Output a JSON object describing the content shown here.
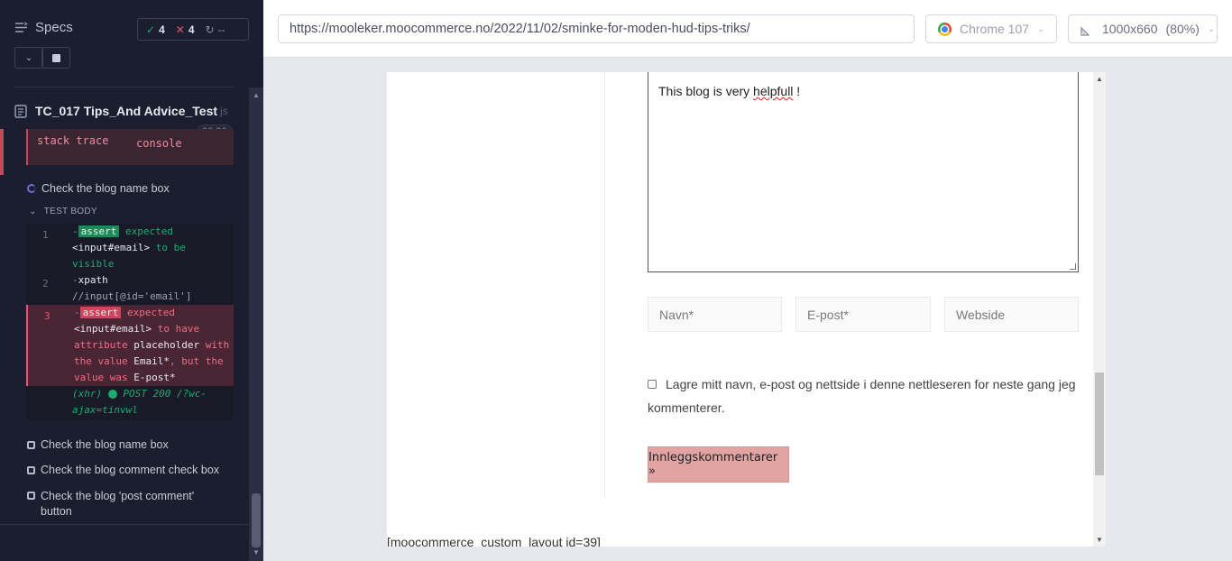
{
  "reporter": {
    "specs_label": "Specs",
    "stats": {
      "passed": "4",
      "failed": "4",
      "pending": "--"
    },
    "spec_file": {
      "name": "TC_017 Tips_And Advice_Test",
      "ext": "js"
    },
    "duration": "00:26",
    "error_links": {
      "stack_trace": "stack trace",
      "console": "console"
    },
    "active_test": "Check the blog name box",
    "test_body_label": "TEST BODY",
    "commands": [
      {
        "num": "1",
        "tag": "assert",
        "text_a": "expected",
        "text_b": "<input#email>",
        "text_c": "to be visible"
      },
      {
        "num": "2",
        "name": "xpath",
        "text_a": "//input[@id='email']"
      },
      {
        "num": "3",
        "tag": "assert",
        "text_a": "expected",
        "text_b": "<input#email>",
        "text_c": "to have attribute",
        "text_d": "placeholder",
        "text_e": "with the value",
        "text_f": "Email*",
        "text_g": ", but the value was",
        "text_h": "E-post*"
      }
    ],
    "xhr": {
      "label": "(xhr)",
      "text": "POST 200 /?wc-ajax=tinvwl"
    },
    "tests": [
      "Check the blog name box",
      "Check the blog comment check box",
      "Check the blog 'post comment' button"
    ]
  },
  "topbar": {
    "url": "https://mooleker.moocommerce.no/2022/11/02/sminke-for-moden-hud-tips-triks/",
    "browser": "Chrome 107",
    "viewport": "1000x660",
    "zoom": "(80%)"
  },
  "page": {
    "comment_text_pre": "This blog is very ",
    "comment_text_word": "helpfull",
    "comment_text_post": " !",
    "fields": {
      "name": "Navn*",
      "email": "E-post*",
      "website": "Webside"
    },
    "consent": "Lagre mitt navn, e-post og nettside i denne nettleseren for neste gang jeg kommenterer.",
    "submit": "Innleggskommentarer »",
    "shortcode": "[moocommerce_custom_layout id=39]"
  }
}
